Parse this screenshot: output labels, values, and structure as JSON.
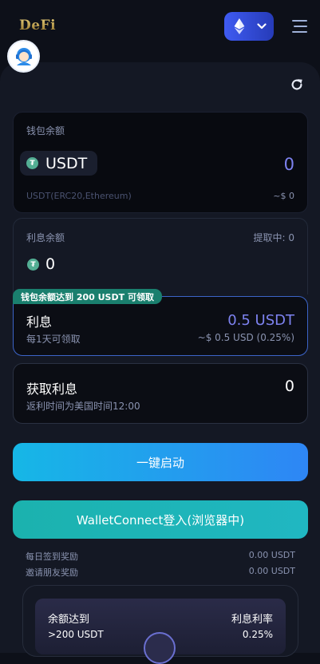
{
  "header": {
    "logo": "DeFi",
    "network_icon": "ethereum-icon"
  },
  "wallet": {
    "title": "钱包余额",
    "token": "USDT",
    "balance": "0",
    "network": "USDT(ERC20,Ethereum)",
    "usd_value": "~$ 0"
  },
  "interest_balance": {
    "title": "利息余额",
    "withdrawing": "提取中: 0",
    "value": "0"
  },
  "rate": {
    "badge": "钱包余额达到 200 USDT 可领取",
    "title": "利息",
    "subtitle": "每1天可领取",
    "amount": "0.5 USDT",
    "usd": "~$ 0.5 USD (0.25%)"
  },
  "collect": {
    "title": "获取利息",
    "subtitle": "返利时间为美国时间12:00",
    "value": "0"
  },
  "buttons": {
    "start": "一键启动",
    "walletconnect": "WalletConnect登入(浏览器中)"
  },
  "rewards": [
    {
      "label": "每日签到奖励",
      "value": "0.00 USDT"
    },
    {
      "label": "邀请朋友奖励",
      "value": "0.00 USDT"
    }
  ],
  "tiers": {
    "col1_header": "余额达到",
    "col2_header": "利息利率",
    "row1_amount": ">200 USDT",
    "row1_rate": "0.25%"
  },
  "colors": {
    "accent_blue": "#3f5bf2",
    "teal": "#1bb2ae",
    "cyan": "#16b7e6",
    "badge_green": "#1a7f6e",
    "amount_purple": "#7d82f0"
  }
}
